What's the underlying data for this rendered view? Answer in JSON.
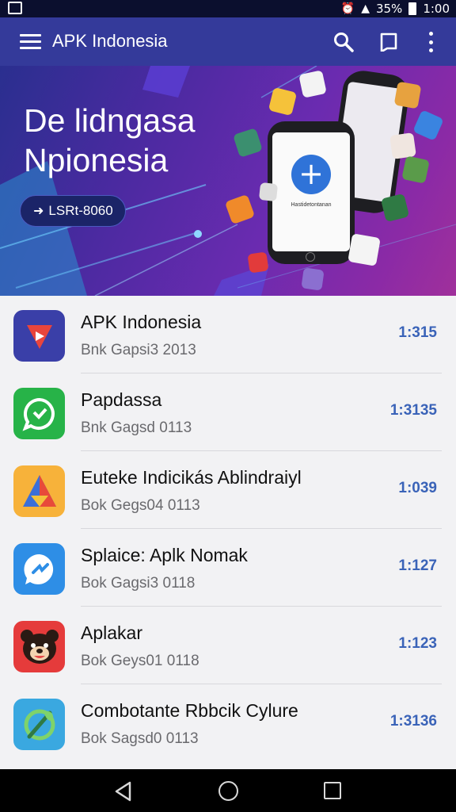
{
  "status_bar": {
    "battery": "35%",
    "time": "1:00"
  },
  "app_bar": {
    "title": "APK Indonesia",
    "icons": [
      "menu-icon",
      "search-icon",
      "bookmark-icon",
      "more-vert-icon"
    ]
  },
  "banner": {
    "title": "De lidngasa\nNpionesia",
    "chip_label": "LSRt-8060",
    "phone_caption": "Hastidetontanan"
  },
  "apps": [
    {
      "name": "APK Indonesia",
      "subtitle": "Bnk Gapsi3 2013",
      "count": "1:315",
      "icon": "play-icon",
      "color": "#3a3fa8"
    },
    {
      "name": "Papdassa",
      "subtitle": "Bnk Gagsd 0113",
      "count": "1:3135",
      "icon": "chat-bubble-icon",
      "color": "#27b348"
    },
    {
      "name": "Euteke Indicikás Ablindraiyl",
      "subtitle": "Bok Gegs04 0113",
      "count": "1:039",
      "icon": "triangle-logo-icon",
      "color": "#f3a02a"
    },
    {
      "name": "Splaice: Aplk Nomak",
      "subtitle": "Bok Gagsi3 0118",
      "count": "1:127",
      "icon": "messenger-icon",
      "color": "#2e8ee6"
    },
    {
      "name": "Aplakar",
      "subtitle": "Bok Geys01 0118",
      "count": "1:123",
      "icon": "bear-face-icon",
      "color": "#e53b3b"
    },
    {
      "name": "Combotante Rbbcik Cylure",
      "subtitle": "Bok Sagsd0 0113",
      "count": "1:3136",
      "icon": "leaf-logo-icon",
      "color": "#3aa8e0"
    }
  ],
  "nav_bar": {
    "icons": [
      "back-icon",
      "home-icon",
      "recents-icon"
    ]
  }
}
